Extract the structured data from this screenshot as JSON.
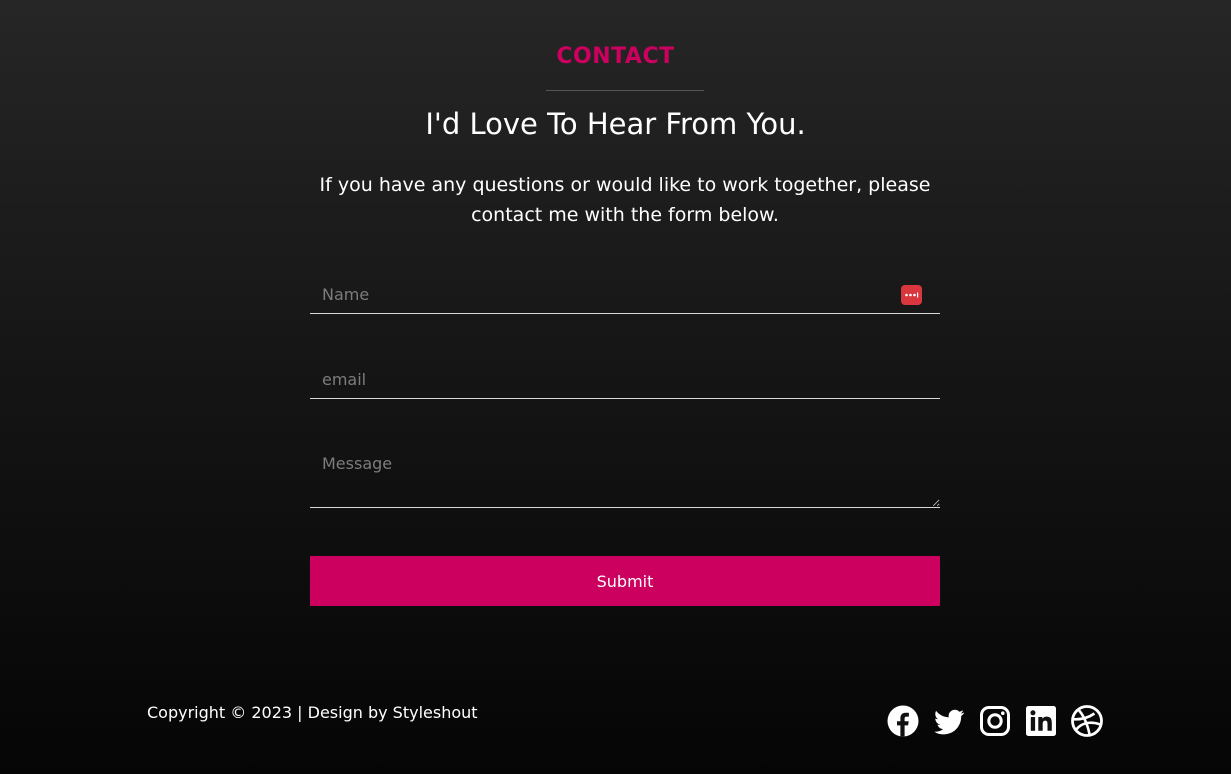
{
  "contact": {
    "label": "CONTACT",
    "heading": "I'd Love To Hear From You.",
    "intro": "If you have any questions or would like to work together, please contact me with the form below."
  },
  "form": {
    "name_placeholder": "Name",
    "name_value": "",
    "email_placeholder": "email",
    "email_value": "",
    "message_placeholder": "Message",
    "message_value": "",
    "submit_label": "Submit"
  },
  "footer": {
    "copyright": "Copyright © 2023 | Design by Styleshout",
    "social_icons": [
      "facebook-icon",
      "twitter-icon",
      "instagram-icon",
      "linkedin-icon",
      "dribbble-icon"
    ]
  },
  "colors": {
    "accent": "#cc005f",
    "password_manager_icon": "#d9363e",
    "text": "#ffffff",
    "placeholder": "#7c7c7c"
  }
}
